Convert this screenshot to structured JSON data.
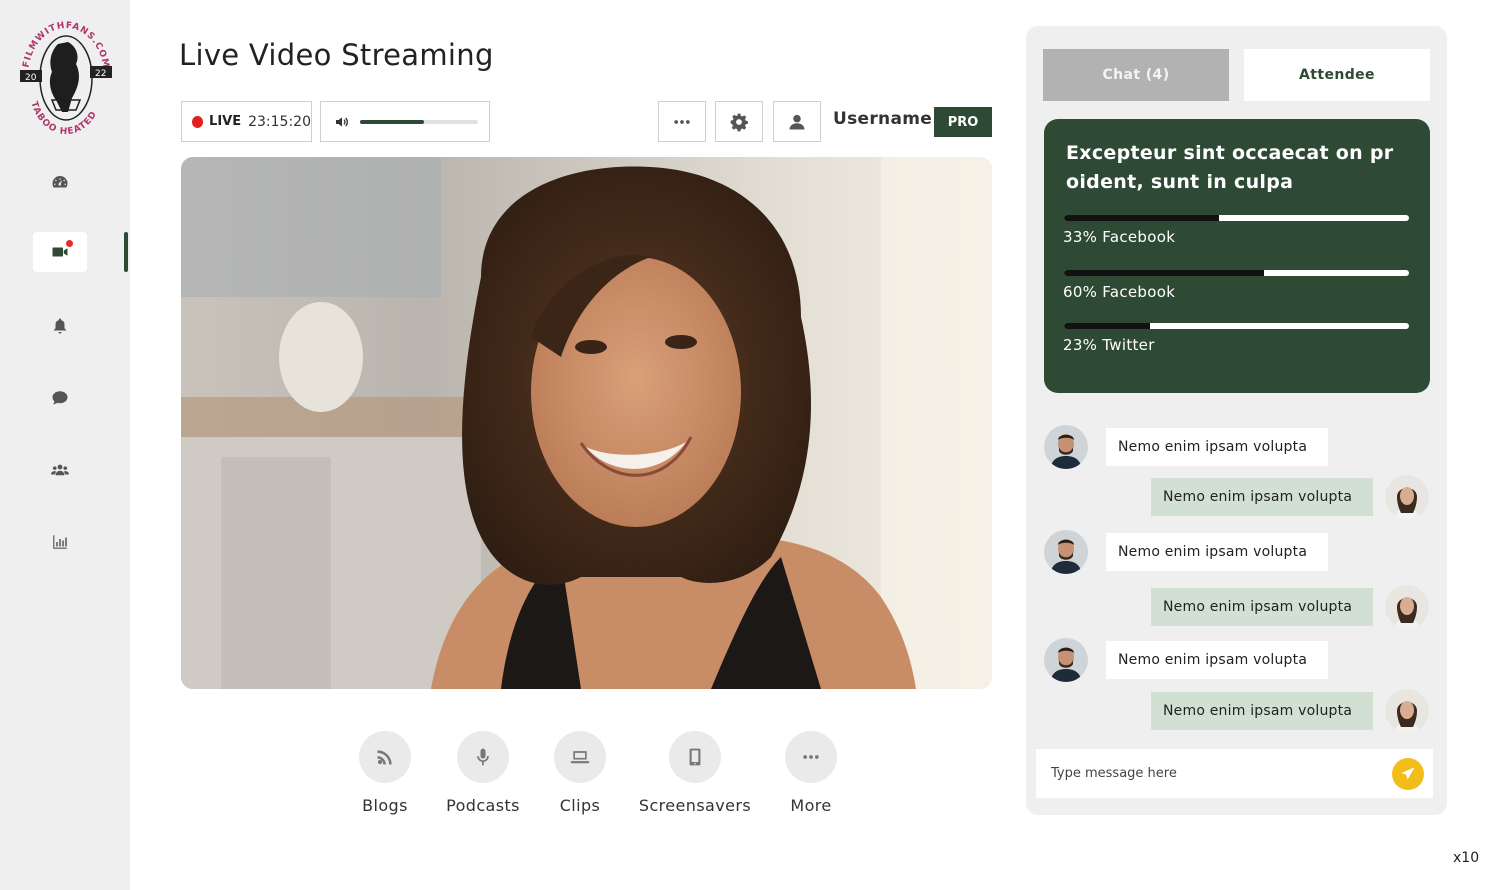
{
  "logo": {
    "top_text": "FILMWITHFANS.COM",
    "bottom_text": "TABOO HEATED",
    "year_left": "20",
    "year_right": "22"
  },
  "sidebar": {
    "items": [
      {
        "name": "dashboard",
        "icon": "gauge-icon"
      },
      {
        "name": "live-video",
        "icon": "video-camera-icon",
        "active": true,
        "notification": true
      },
      {
        "name": "notifications",
        "icon": "bell-icon"
      },
      {
        "name": "messages",
        "icon": "chat-bubble-icon"
      },
      {
        "name": "users",
        "icon": "users-group-icon"
      },
      {
        "name": "analytics",
        "icon": "bar-chart-icon"
      }
    ]
  },
  "header": {
    "title": "Live Video Streaming",
    "live_label": "LIVE",
    "live_time": "23:15:20",
    "volume_percent": 54,
    "username": "Username",
    "badge": "PRO"
  },
  "media_buttons": [
    {
      "label": "Blogs",
      "icon": "blog-feed-icon"
    },
    {
      "label": "Podcasts",
      "icon": "microphone-icon"
    },
    {
      "label": "Clips",
      "icon": "laptop-icon"
    },
    {
      "label": "Screensavers",
      "icon": "phone-icon"
    },
    {
      "label": "More",
      "icon": "more-dots-icon"
    }
  ],
  "panel": {
    "tabs": {
      "chat": "Chat (4)",
      "attendee": "Attendee"
    },
    "poll": {
      "question": "Excepteur sint occaecat on pr oident, sunt in culpa",
      "options": [
        {
          "label": "33% Facebook",
          "percent": 45
        },
        {
          "label": "60% Facebook",
          "percent": 58
        },
        {
          "label": "23% Twitter",
          "percent": 25
        }
      ]
    },
    "messages": [
      {
        "text": "Nemo enim ipsam volupta",
        "direction": "in"
      },
      {
        "text": "Nemo enim ipsam volupta",
        "direction": "out"
      },
      {
        "text": "Nemo enim ipsam volupta",
        "direction": "in"
      },
      {
        "text": "Nemo enim ipsam volupta",
        "direction": "out"
      },
      {
        "text": "Nemo enim ipsam volupta",
        "direction": "in"
      },
      {
        "text": "Nemo enim ipsam volupta",
        "direction": "out"
      }
    ],
    "composer": {
      "placeholder": "Type message here"
    }
  },
  "zoom": "x10",
  "colors": {
    "accent": "#2e4a35",
    "live_red": "#e01f1f",
    "send_yellow": "#f2bd18",
    "outgoing_bubble": "#d2e0d4"
  }
}
